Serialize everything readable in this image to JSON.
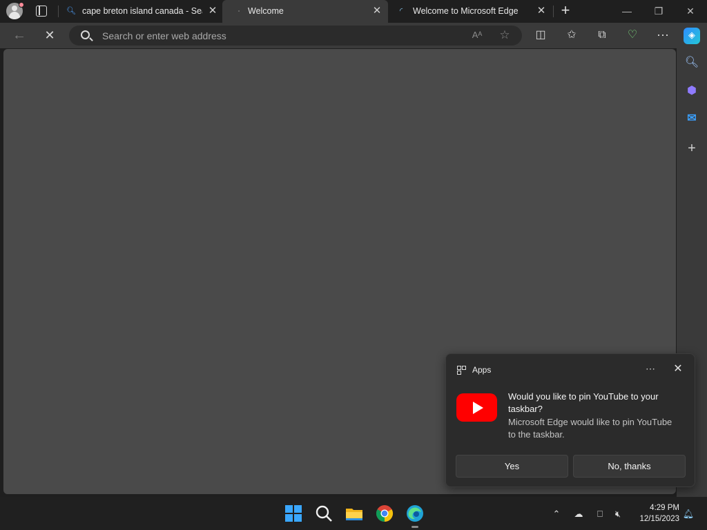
{
  "tabs": [
    {
      "title": "cape breton island canada - Sear",
      "icon": "search-icon",
      "active": false
    },
    {
      "title": "Welcome",
      "icon": "loading-icon",
      "active": true
    },
    {
      "title": "Welcome to Microsoft Edge",
      "icon": "loading-icon",
      "active": false
    }
  ],
  "toolbar": {
    "address_placeholder": "Search or enter web address",
    "icons": [
      "back-icon",
      "stop-icon",
      "read-aloud-icon",
      "favorite-star-icon",
      "split-screen-icon",
      "favorites-icon",
      "collections-icon",
      "browser-essentials-icon",
      "more-icon",
      "copilot-icon"
    ]
  },
  "sidebar": {
    "icons": [
      "search-icon",
      "copilot-icon",
      "outlook-icon",
      "add-icon"
    ]
  },
  "notification": {
    "app_name": "Apps",
    "title": "Would you like to pin YouTube to your taskbar?",
    "message": "Microsoft Edge would like to pin YouTube to the taskbar.",
    "yes_label": "Yes",
    "no_label": "No, thanks"
  },
  "taskbar": {
    "apps": [
      "start-icon",
      "search-icon",
      "file-explorer-icon",
      "chrome-icon",
      "edge-icon"
    ],
    "time": "4:29 PM",
    "date": "12/15/2023"
  },
  "colors": {
    "accent_youtube": "#ff0000",
    "content_bg": "#4a4a4a",
    "toolbar_bg": "#3a3a3a",
    "titlebar_bg": "#1f1f1f"
  }
}
